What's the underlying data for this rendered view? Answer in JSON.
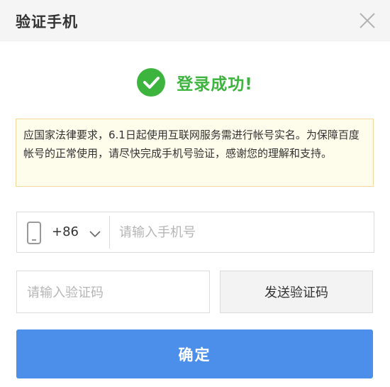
{
  "dialog": {
    "title": "验证手机",
    "close_icon": "close-icon"
  },
  "success": {
    "icon": "check-circle-icon",
    "color": "#3db43d",
    "message": "登录成功!"
  },
  "notice": {
    "text": "应国家法律要求，6.1日起使用互联网服务需进行帐号实名。为保障百度帐号的正常使用，请尽快完成手机号验证，感谢您的理解和支持。"
  },
  "phone": {
    "icon": "mobile-phone-icon",
    "country_code": "+86",
    "chevron_icon": "chevron-down-icon",
    "placeholder": "请输入手机号"
  },
  "verify_code": {
    "placeholder": "请输入验证码",
    "send_label": "发送验证码"
  },
  "confirm": {
    "label": "确定",
    "color": "#4c8fea"
  }
}
